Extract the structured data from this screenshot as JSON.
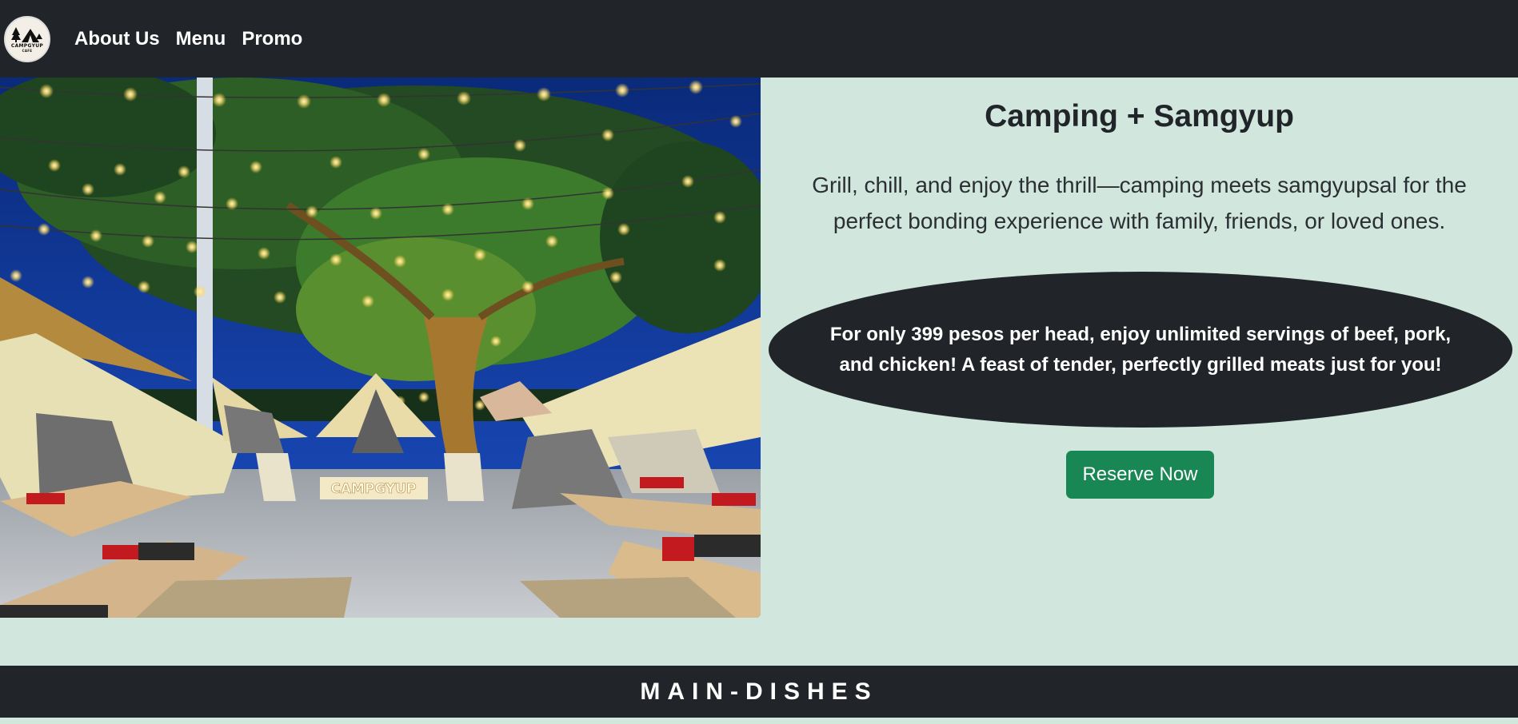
{
  "navbar": {
    "logo": {
      "text": "CAMPGYUP",
      "subtext": "CAFE",
      "icon": "tent-trees-logo"
    },
    "links": [
      "About Us",
      "Menu",
      "Promo"
    ]
  },
  "hero": {
    "image": {
      "icon": "campsite-night-photo",
      "sign_text": "CAMPGYUP"
    },
    "title": "Camping + Samgyup",
    "description": "Grill, chill, and enjoy the thrill—camping meets samgyupsal for the perfect bonding experience with family, friends, or loved ones.",
    "promo": "For only 399 pesos per head, enjoy unlimited servings of beef, pork, and chicken! A feast of tender, perfectly grilled meats just for you!",
    "cta_label": "Reserve Now"
  },
  "section": {
    "title": "MAIN-DISHES"
  },
  "colors": {
    "navbar_bg": "#212529",
    "page_bg": "#d1e7dd",
    "button_bg": "#198754",
    "text": "#212529"
  }
}
